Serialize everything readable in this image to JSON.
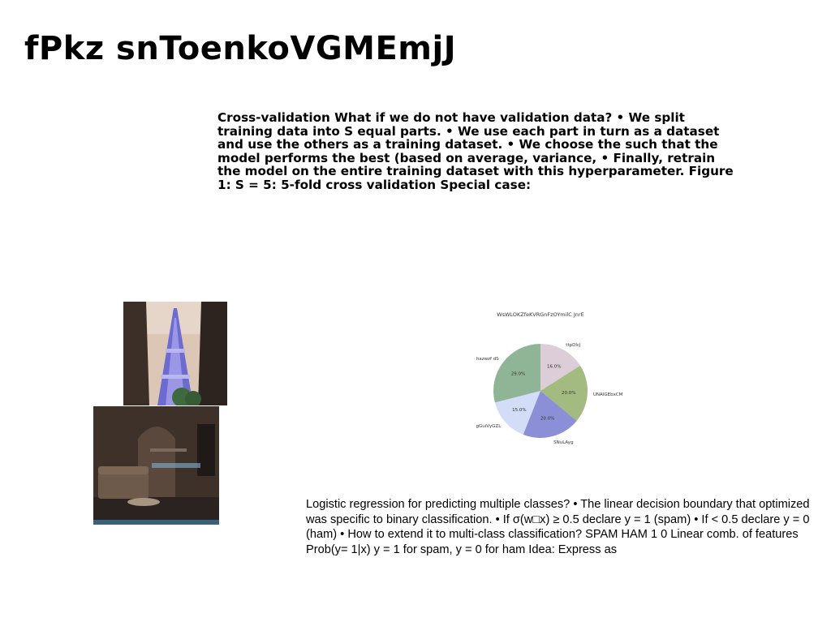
{
  "page": {
    "title": "fPkz snToenkoVGMEmjJ"
  },
  "text_block_1": "Cross-validation What if we do not have validation data? • We split training data into S equal parts. • We use each part in turn as a dataset and use the others as a training dataset. • We choose the such that the model performs the best (based on average, variance, • Finally, retrain the model on the entire training dataset with this hyperparameter. Figure 1: S = 5: 5-fold cross validation Special case:",
  "text_block_2": "Logistic regression for predicting multiple classes? • The linear decision boundary that optimized was specific to binary classification. • If σ(w□x) ≥ 0.5 declare y = 1 (spam) • If < 0.5 declare y = 0 (ham) • How to extend it to multi-class classification? SPAM HAM 1 0 Linear comb. of features Prob(y= 1|x) y = 1 for spam, y = 0 for ham Idea: Express as",
  "chart_data": {
    "type": "pie",
    "title": "WsWLOKZfeKVRGnFzOYmilC JnrE",
    "start_angle": 90,
    "direction": "clockwise",
    "slices": [
      {
        "label": "ttpDlcj",
        "value": 16.0,
        "pct_label": "16.0%",
        "color": "#dccdd8"
      },
      {
        "label": "UNAIGEbxCM",
        "value": 20.0,
        "pct_label": "20.0%",
        "color": "#a3bb80"
      },
      {
        "label": "SNuLAyg",
        "value": 20.0,
        "pct_label": "20.0%",
        "color": "#8b8fd6"
      },
      {
        "label": "gGuiVyGZL",
        "value": 15.0,
        "pct_label": "15.0%",
        "color": "#d3ddf8"
      },
      {
        "label": "hazwzf dS",
        "value": 29.0,
        "pct_label": "29.0%",
        "color": "#8fb596"
      }
    ]
  },
  "images": {
    "tower": "tower-photo",
    "room": "room-photo"
  }
}
